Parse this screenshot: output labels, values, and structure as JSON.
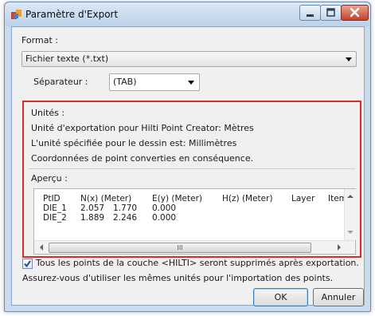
{
  "window": {
    "title": "Paramètre d'Export"
  },
  "format": {
    "label": "Format :",
    "selected": "Fichier texte (*.txt)"
  },
  "separator": {
    "label": "Séparateur :",
    "selected": "(TAB)"
  },
  "units": {
    "label": "Unités :",
    "line1": "Unité d'exportation pour Hilti Point Creator: Mètres",
    "line2": "L'unité spécifiée pour le dessin est: Millimètres",
    "line3": "Coordonnées de point converties en conséquence."
  },
  "preview": {
    "label": "Aperçu :",
    "headers": [
      "PtID",
      "N(x) (Meter)",
      "E(y) (Meter)",
      "H(z) (Meter)",
      "Layer",
      "Item Nc"
    ],
    "rows": [
      [
        "DIE_1",
        "2.057",
        "1.770",
        "0.000"
      ],
      [
        "DIE_2",
        "1.889",
        "2.246",
        "0.000"
      ]
    ],
    "hscroll_grip": "III"
  },
  "delete_checkbox": {
    "checked": true,
    "label": "Tous les points de la couche <HILTI> seront supprimés après exportation."
  },
  "note": "Assurez-vous d'utiliser les mêmes unités pour l'importation des points.",
  "buttons": {
    "ok": "OK",
    "cancel": "Annuler"
  },
  "colors": {
    "highlight_border": "#d32f2f",
    "close_button": "#c4422d",
    "checkbox_check": "#1f4fa0"
  }
}
